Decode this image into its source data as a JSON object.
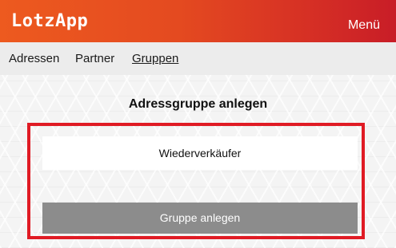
{
  "header": {
    "logo": "LotzApp",
    "menu_label": "Menü"
  },
  "nav": {
    "items": [
      {
        "label": "Adressen"
      },
      {
        "label": "Partner"
      },
      {
        "label": "Gruppen"
      }
    ]
  },
  "form": {
    "title": "Adressgruppe anlegen",
    "group_name_value": "Wiederverkäufer",
    "submit_label": "Gruppe anlegen"
  },
  "colors": {
    "header_start": "#ed5a1f",
    "header_end": "#c81d27",
    "highlight_border": "#e01b24",
    "button_bg": "#8c8c8c"
  }
}
